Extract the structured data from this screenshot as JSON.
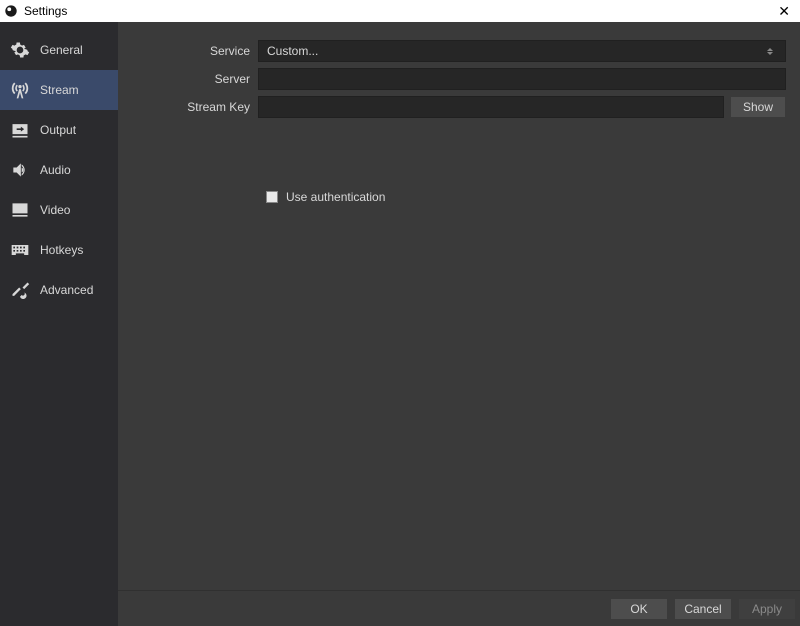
{
  "window": {
    "title": "Settings"
  },
  "sidebar": {
    "items": [
      {
        "label": "General"
      },
      {
        "label": "Stream"
      },
      {
        "label": "Output"
      },
      {
        "label": "Audio"
      },
      {
        "label": "Video"
      },
      {
        "label": "Hotkeys"
      },
      {
        "label": "Advanced"
      }
    ],
    "active_index": 1
  },
  "form": {
    "service": {
      "label": "Service",
      "value": "Custom..."
    },
    "server": {
      "label": "Server",
      "value": ""
    },
    "stream_key": {
      "label": "Stream Key",
      "value": "",
      "show_button": "Show"
    },
    "use_auth": {
      "label": "Use authentication",
      "checked": false
    }
  },
  "footer": {
    "ok": "OK",
    "cancel": "Cancel",
    "apply": "Apply"
  }
}
